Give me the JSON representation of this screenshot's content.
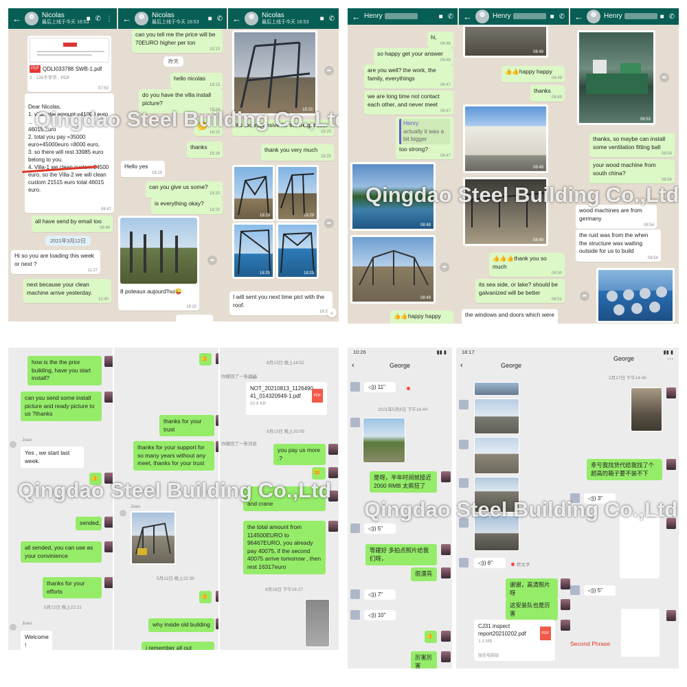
{
  "watermark": "Qingdao Steel Building Co.,Ltd",
  "wa": {
    "brand_color": "#075e54",
    "time_icon": "double-check-icon",
    "nicolas_chat": {
      "contact": "Nicolas",
      "last_seen": "最后上线于今天 16:53",
      "file_label": "QDLI033788 SWB-1.pdf",
      "file_meta": "2 · 135千字节 · PDF",
      "file_time": "07:50",
      "quote_text": "Dear Nicolas,\n1. villa total amount =41000 euro\n...\n46015 euro\n2. total you pay =35000 euro+45000euro =8000 euro,\n3. so there will rest 33985 euro belong to you.\n4. Villa-1 we clean custom 24500 euro, so the Villa-2 we will clean custom 21515 euro total 46015 euro.",
      "quote_time": "08:47",
      "send_email": "all have send by email too",
      "send_email_time": "08:48",
      "date_chip": "2021年3月12日",
      "q_loading": "Hi so you are loading this week or next ?",
      "q_loading_time": "11:27",
      "a_next": "next because your clean machine arrive yesterday.",
      "a_next_time": "12:40"
    },
    "nicolas_chat_2": {
      "contact": "Nicolas",
      "last_seen": "最后上线于今天 16:53",
      "m1": "can you tell me the price will be 70EURO higher per ton",
      "m1_time": "18:13",
      "m2": "昨天",
      "m3": "hello nicolas",
      "m3_time": "18:13",
      "m4": "do you have the villa install picture?",
      "m4_time": "18:14",
      "m5_time": "18:15",
      "m6": "thanks",
      "m6_time": "18:16",
      "m7": "Hello yes",
      "m7_time": "18:19",
      "m8": "can you give us some?",
      "m8_time": "18:20",
      "m9": "is everything okay?",
      "m9_time": "18:20",
      "m10": "8 poteaux aujourd'hui😜",
      "m10_time": "18:20"
    },
    "nicolas_chat_3": {
      "contact": "Nicolas",
      "last_seen": "最后上线于今天 16:53",
      "p1_time": "18:23",
      "m1": "it's too expensive for the freight cost",
      "m1_time": "18:25",
      "m2": "thank you very much",
      "m2_time": "18:25",
      "g1_time": "18:29",
      "g2_time": "18:29",
      "g3_time": "18:29",
      "g4_time": "18:29",
      "m3": "I will sent you next time pict with the roof.",
      "m3_time": "18:30"
    },
    "henry_chat_1": {
      "contact": "Henry",
      "m1": "hi,",
      "m1_time": "08:46",
      "m2": "so happy get your answer",
      "m2_time": "08:46",
      "m3": "are you well? the work, the family, everythings",
      "m3_time": "08:47",
      "m4": "we are long time not contact each other, and never meet",
      "m4_time": "08:47",
      "quote_name": "Henry",
      "quote_text": "actually it was a bit bigger",
      "m5": "too strong?",
      "m5_time": "08:47",
      "p1_time": "08:48",
      "p2_time": "08:49",
      "m6": "happy happy",
      "m6_emoji": "👍👍"
    },
    "henry_chat_2": {
      "contact": "Henry",
      "p0_time": "08:49",
      "m1": "happy happy",
      "m1_emoji": "👍👍",
      "m1_time": "08:49",
      "m2": "thanks",
      "m2_time": "08:49",
      "p1_time": "08:49",
      "p2_time": "08:49",
      "m3": "thank you so much",
      "m3_emoji": "👍👍👍",
      "m3_time": "08:50",
      "m4": "its sea side, or lake? should be galvanized will be better",
      "m4_time": "08:51",
      "m5": "the windows and doors which were"
    },
    "henry_chat_3": {
      "contact": "Henry",
      "p1_time": "08:53",
      "m1": "thanks, so maybe can install some ventilation fitting ball",
      "m1_time": "08:54",
      "m2": "your wood machine from south china?",
      "m2_time": "08:54",
      "m3": "wood machines are from germany",
      "m3_time": "08:54",
      "m4": "the rust was from the when the structure was waiting outside for us to build",
      "m4_time": "08:54"
    }
  },
  "wx": {
    "green": "#95ec69",
    "left": {
      "m1": "how is the the prior building, have you start install?",
      "m2": "can you send some install picture and ready picture to us ?thanks",
      "sender1": "Joao",
      "m3": "Yes , we start last week.",
      "m4": "sended,",
      "sender2": "Joao",
      "m5": "all sended, you can use as your convinience",
      "m6": "thanks for your efforts",
      "ts1": "5月22日 晚上22:38",
      "ts2": "5月22日 晚上22:21",
      "sender3": "Joao",
      "m7": "Welcome !"
    },
    "right": {
      "ts1": "8月13日 晚上18:52",
      "recall1": "你撤回了一条消息",
      "sender1": "Joao",
      "file_name": "NOT_20210813_1126490 41_014320949-1.pdf",
      "file_size": "32.8 KB",
      "file_badge": "PDF",
      "m1": "thanks for your trust",
      "ts2": "8月13日 晚上20:09",
      "recall2": "你撤回了一条消息",
      "m2": "thanks for your support for so many years without any meet, thanks for your trust",
      "m3": "you pay us more .?",
      "m4": "and crane",
      "m5": "the total amount from 114500EURO to 96467EURO, you already pay 40075, if the second 40075 arrive tomorrow , then rest 16317euro",
      "ts3": "8月18日 下午16:27",
      "m6": "why inside old building",
      "m7": "i remember all out building"
    }
  },
  "george1": {
    "clock": "10:26",
    "title": "George",
    "v1": "11\"",
    "ts1": "2021年5月8日 下午16:44",
    "m1": "是呀，半年时间就接近 2000 RMB 太疯狂了",
    "v2": "5\"",
    "m2": "等建好 多拍点照片给我们呀，",
    "m3": "很漂亮",
    "v3": "7\"",
    "v4": "10\"",
    "m4": "厉害厉害"
  },
  "george2": {
    "clock": "18:17",
    "title": "George",
    "ts1": "2月17日 下午14:45",
    "m1": "幸亏我找货代给我找了个超高的箱子要不装不下",
    "v1": "3\"",
    "v2": "6\"",
    "v3": "5\"",
    "transcribe": "转文字",
    "m2": "谢谢，高清照片呀",
    "m3": "这安装队也是厉害",
    "file_name": "CJ31 inspect report20210202.pdf",
    "file_size": "1.3 MB",
    "file_source": "微信电脑版",
    "file_badge": "PDF",
    "second_phrase": "Second Phrase"
  }
}
